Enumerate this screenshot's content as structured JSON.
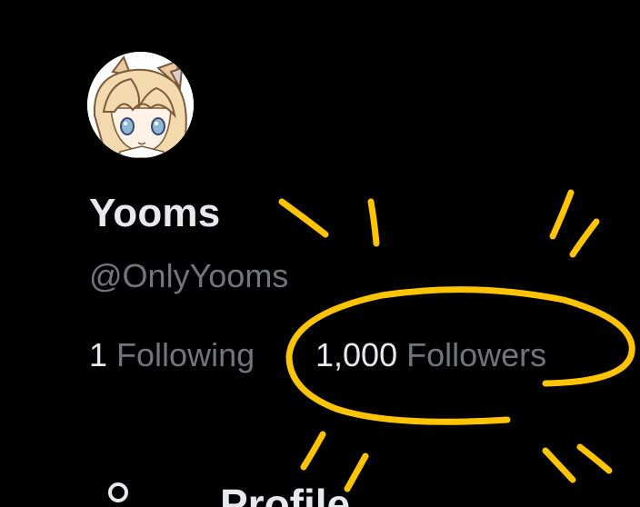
{
  "profile": {
    "display_name": "Yooms",
    "handle": "@OnlyYooms",
    "avatar_icon": "anime-avatar-icon"
  },
  "stats": {
    "following_count": "1",
    "following_label": "Following",
    "followers_count": "1,000",
    "followers_label": "Followers"
  },
  "nav": {
    "profile_label": "Profile",
    "profile_icon": "person-icon"
  },
  "colors": {
    "background": "#000000",
    "primary_text": "#e7e9ea",
    "secondary_text": "#71767b",
    "highlight": "#ffc400"
  }
}
